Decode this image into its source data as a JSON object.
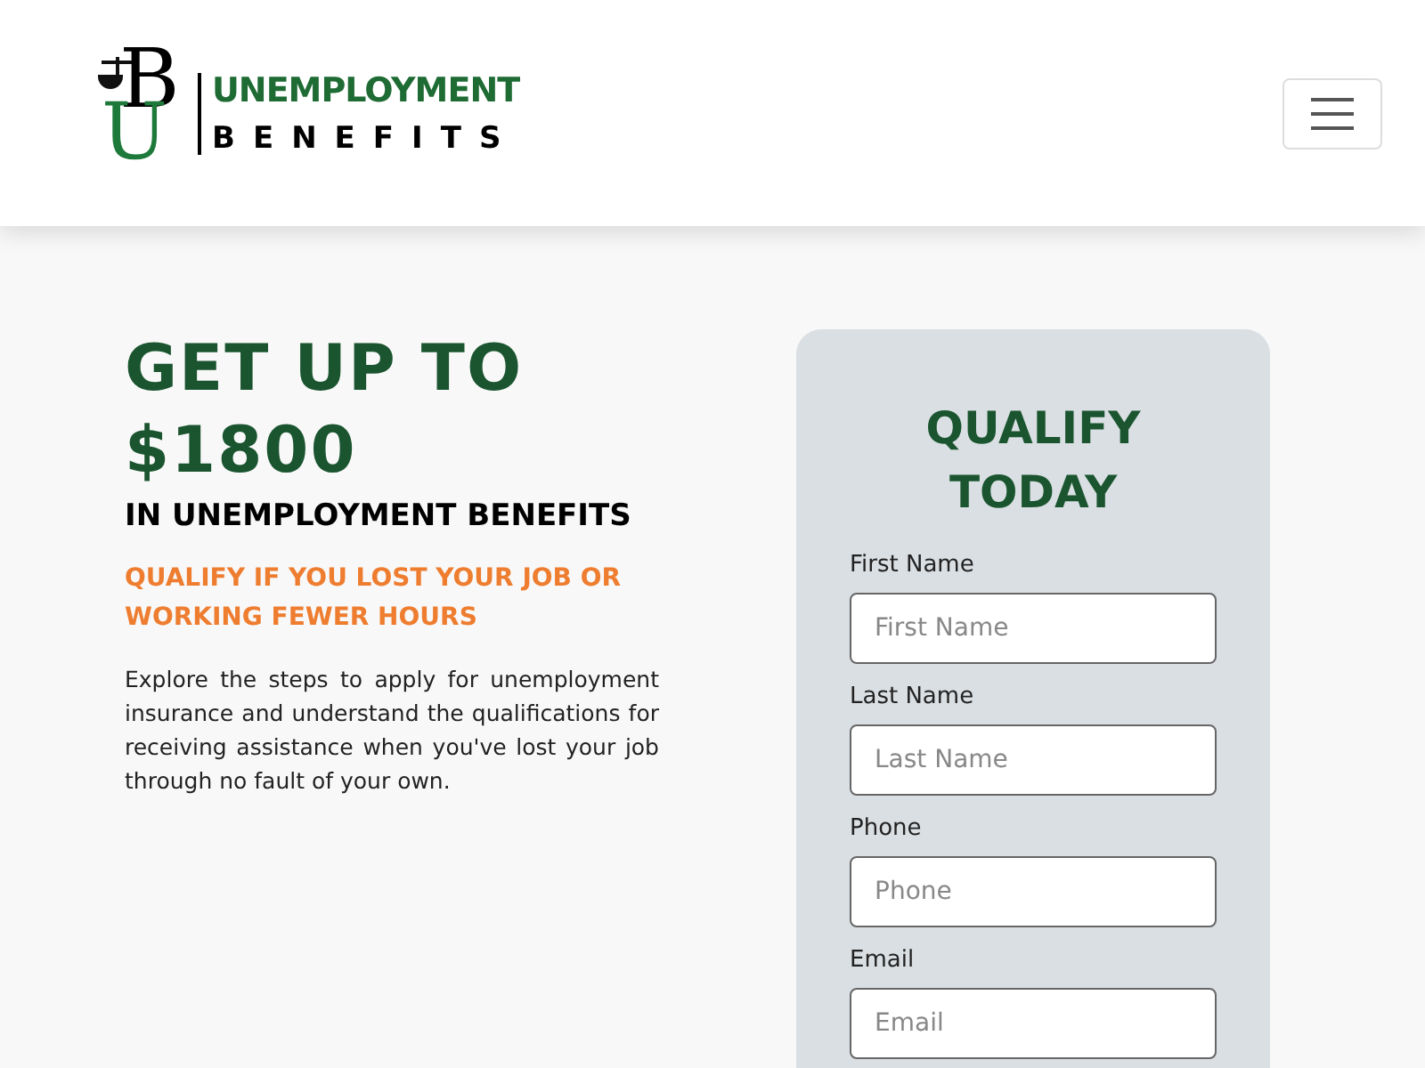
{
  "header": {
    "logo": {
      "initial_top": "B",
      "initial_bottom": "U",
      "line_1": "UNEMPLOYMENT",
      "line_2": "BENEFITS"
    },
    "menu_button": {
      "expanded": false
    }
  },
  "hero": {
    "headline": "GET UP TO $1800",
    "subheadline": "IN UNEMPLOYMENT BENEFITS",
    "tagline": "QUALIFY IF YOU LOST YOUR JOB OR WORKING FEWER HOURS",
    "description": "Explore the steps to apply for unemployment insurance and understand the qualifications for receiving assistance when you've lost your job through no fault of your own."
  },
  "form": {
    "title": "QUALIFY TODAY",
    "fields": [
      {
        "label": "First Name",
        "placeholder": "First Name"
      },
      {
        "label": "Last Name",
        "placeholder": "Last Name"
      },
      {
        "label": "Phone",
        "placeholder": "Phone"
      },
      {
        "label": "Email",
        "placeholder": "Email"
      }
    ]
  }
}
